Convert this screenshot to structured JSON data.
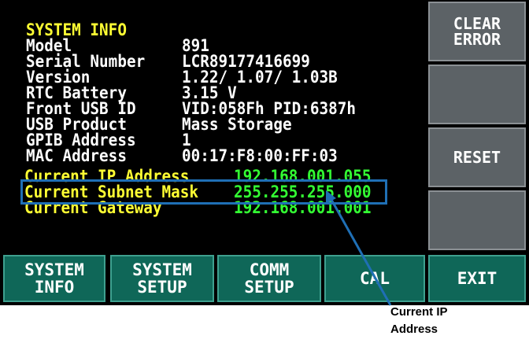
{
  "title": "SYSTEM INFO",
  "rows": [
    {
      "label": "Model",
      "value": "891"
    },
    {
      "label": "Serial Number",
      "value": "LCR89177416699"
    },
    {
      "label": "Version",
      "value": "1.22/ 1.07/ 1.03B"
    },
    {
      "label": "RTC Battery",
      "value": "3.15 V"
    },
    {
      "label": "Front USB ID",
      "value": "VID:058Fh PID:6387h"
    },
    {
      "label": "USB Product",
      "value": "Mass Storage"
    },
    {
      "label": "GPIB Address",
      "value": "1"
    },
    {
      "label": "MAC Address",
      "value": "00:17:F8:00:FF:03"
    }
  ],
  "network": [
    {
      "label": "Current IP Address",
      "value": "192.168.001.055"
    },
    {
      "label": "Current Subnet Mask",
      "value": "255.255.255.000"
    },
    {
      "label": "Current Gateway",
      "value": "192.168.001.001"
    }
  ],
  "side_buttons": [
    {
      "line1": "CLEAR",
      "line2": "ERROR"
    },
    {
      "line1": "",
      "line2": ""
    },
    {
      "line1": "RESET",
      "line2": ""
    },
    {
      "line1": "",
      "line2": ""
    }
  ],
  "soft_buttons": [
    {
      "line1": "SYSTEM",
      "line2": "INFO"
    },
    {
      "line1": "SYSTEM",
      "line2": "SETUP"
    },
    {
      "line1": "COMM",
      "line2": "SETUP"
    },
    {
      "line1": "CAL",
      "line2": ""
    },
    {
      "line1": "EXIT",
      "line2": ""
    }
  ],
  "callout": {
    "line1": "Current IP",
    "line2": "Address"
  },
  "colors": {
    "highlight": "#1f6fb5",
    "screen": "#000000",
    "soft_button": "#0f6758",
    "side_button": "#5c6266"
  }
}
